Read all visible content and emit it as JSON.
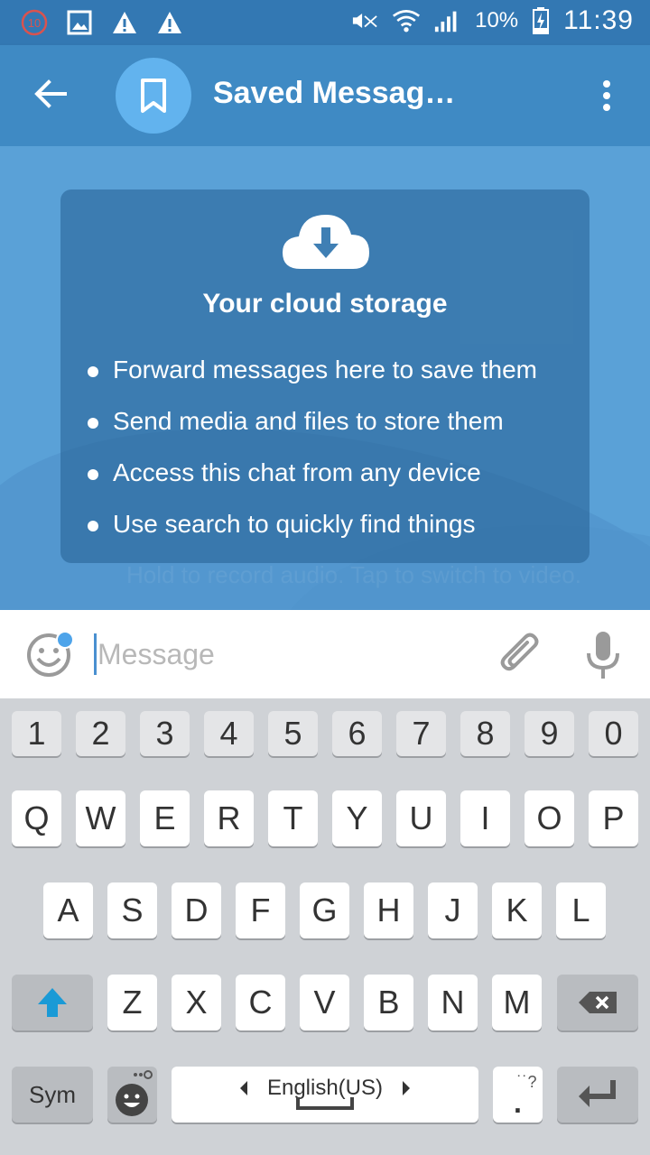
{
  "status_bar": {
    "notification_icons": [
      "counter-10-icon",
      "gallery-icon",
      "warning-icon",
      "warning-icon"
    ],
    "notification_count": "10",
    "battery_percent": "10%",
    "time": "11:39",
    "icons": [
      "mute-icon",
      "wifi-icon",
      "signal-icon",
      "battery-charging-icon"
    ]
  },
  "app_bar": {
    "title": "Saved Messag…",
    "back_icon": "arrow-left-icon",
    "avatar_icon": "bookmark-icon",
    "menu_icon": "more-vertical-icon",
    "colors": {
      "bar": "#3f8ac4",
      "avatar": "#62b3ee"
    }
  },
  "chat": {
    "background_color": "#5aa1d7",
    "ghost_hint": "Hold to record audio. Tap to switch to video.",
    "card": {
      "icon": "cloud-download-icon",
      "title": "Your cloud storage",
      "items": [
        "Forward messages here to save them",
        "Send media and files to store them",
        "Access this chat from any device",
        "Use search to quickly find things"
      ]
    }
  },
  "input_bar": {
    "placeholder": "Message",
    "value": "",
    "emoji_icon": "smiley-icon",
    "attach_icon": "paperclip-icon",
    "mic_icon": "microphone-icon"
  },
  "keyboard": {
    "number_row": [
      "1",
      "2",
      "3",
      "4",
      "5",
      "6",
      "7",
      "8",
      "9",
      "0"
    ],
    "row1": [
      "Q",
      "W",
      "E",
      "R",
      "T",
      "Y",
      "U",
      "I",
      "O",
      "P"
    ],
    "row2": [
      "A",
      "S",
      "D",
      "F",
      "G",
      "H",
      "J",
      "K",
      "L"
    ],
    "row3": [
      "Z",
      "X",
      "C",
      "V",
      "B",
      "N",
      "M"
    ],
    "sym_label": "Sym",
    "language_label": "English(US)",
    "punctuation_hint": "˙˙?",
    "period": ".",
    "shift_icon": "shift-arrow-icon",
    "backspace_icon": "backspace-icon",
    "enter_icon": "enter-icon",
    "emoji_settings_icon": "emoji-settings-icon"
  }
}
